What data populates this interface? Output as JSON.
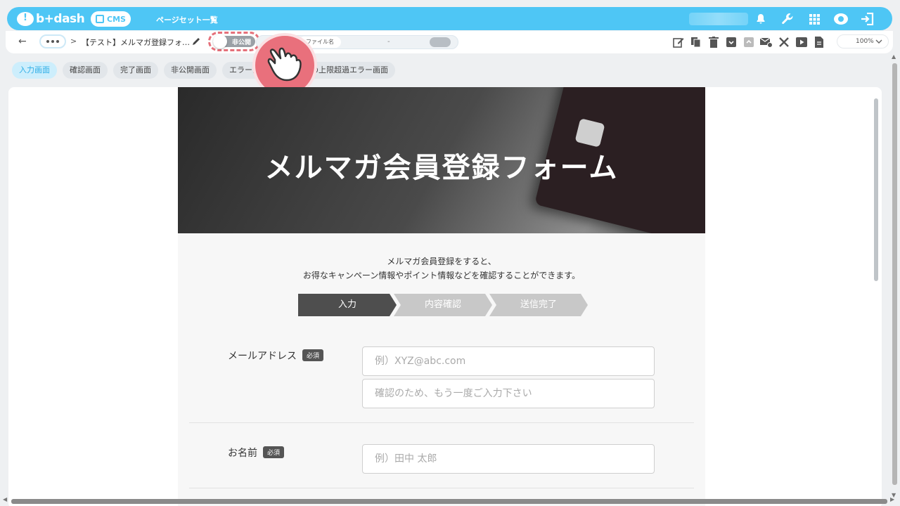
{
  "header": {
    "logo_text": "b+dash",
    "cms_label": "CMS",
    "pageset_label": "ページセット一覧",
    "icons": [
      "bell-icon",
      "wrench-icon",
      "apps-grid-icon",
      "support-icon",
      "logout-icon"
    ]
  },
  "toolbar": {
    "back_label": "←",
    "breadcrumb_sep": ">",
    "page_title": "【テスト】メルマガ登録フォ…",
    "toggle_label": "非公開",
    "filename_tag": "ファイル名",
    "filename_value": "-",
    "zoom": "100%",
    "action_icons": [
      "edit-icon",
      "copy-icon",
      "trash-icon",
      "archive-icon",
      "archive-disabled-icon",
      "mail-settings-icon",
      "tools-icon",
      "play-icon",
      "document-icon"
    ]
  },
  "tabs": [
    {
      "label": "入力画面",
      "active": true
    },
    {
      "label": "確認画面",
      "active": false
    },
    {
      "label": "完了画面",
      "active": false
    },
    {
      "label": "非公開画面",
      "active": false
    },
    {
      "label": "エラー画面",
      "active": false
    },
    {
      "label": "会員数の上限超過エラー画面",
      "active": false
    }
  ],
  "preview": {
    "hero_title": "メルマガ会員登録フォーム",
    "intro_line1": "メルマガ会員登録をすると、",
    "intro_line2": "お得なキャンペーン情報やポイント情報などを確認することができます。",
    "steps": [
      "入力",
      "内容確認",
      "送信完了"
    ],
    "fields": {
      "email_label": "メールアドレス",
      "required_badge": "必須",
      "email_placeholder": "例）XYZ@abc.com",
      "email_confirm_placeholder": "確認のため、もう一度ご入力下さい",
      "name_label": "お名前",
      "name_placeholder": "例）田中 太郎"
    }
  },
  "colors": {
    "accent": "#4ec6f5",
    "pointer": "#e9707c",
    "step_active": "#4e4e4e",
    "step_inactive": "#c8c8c8"
  }
}
